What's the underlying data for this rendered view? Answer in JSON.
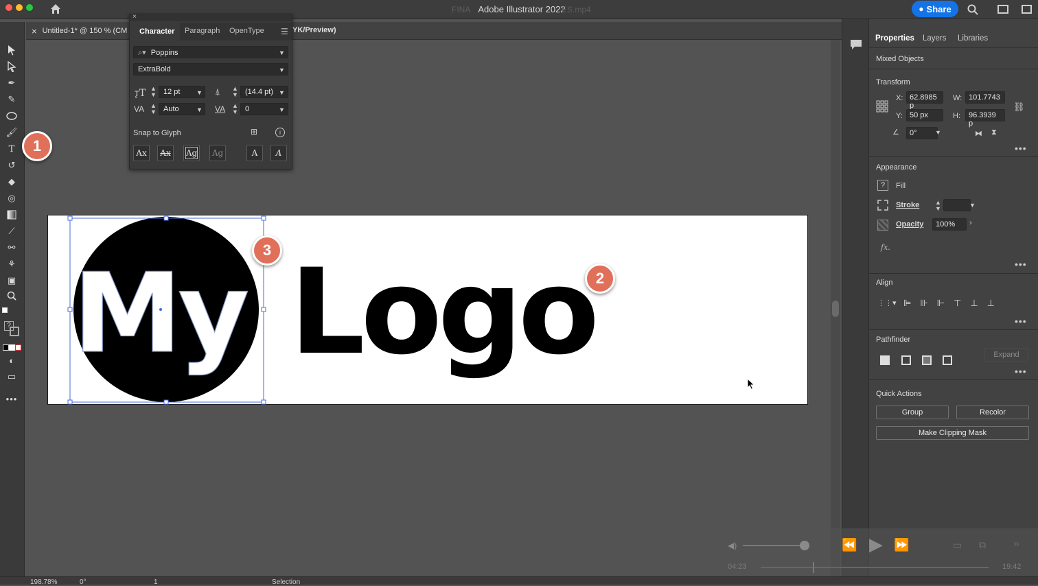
{
  "window": {
    "title": "Adobe Illustrator 2022",
    "faded_filename_left": "FINA",
    "faded_filename_right": "ES.mp4",
    "share_label": "Share"
  },
  "document_tab": {
    "close_glyph": "×",
    "label": "Untitled-1* @ 150 % (CM",
    "label_suffix": "YK/Preview)"
  },
  "character_panel": {
    "tabs": [
      "Character",
      "Paragraph",
      "OpenType"
    ],
    "active_tab": "Character",
    "font_family": "Poppins",
    "font_style": "ExtraBold",
    "font_size": "12 pt",
    "leading": "(14.4 pt)",
    "kerning": "Auto",
    "tracking": "0",
    "snap_to_glyph_label": "Snap to Glyph",
    "glyph_buttons": [
      "Ax",
      "Ax",
      "Ag",
      "Ag",
      "A",
      "A"
    ]
  },
  "artboard": {
    "logo_circle_text": "My",
    "logo_text": "Logo",
    "logo_circle_color": "#000000",
    "logo_text_color": "#000000"
  },
  "badges": [
    "1",
    "2",
    "3"
  ],
  "badge_color": "#e0705a",
  "properties_panel": {
    "tabs": [
      "Properties",
      "Layers",
      "Libraries"
    ],
    "active_tab": "Properties",
    "selection_type": "Mixed Objects",
    "transform": {
      "title": "Transform",
      "x_label": "X:",
      "x_value": "62.8985 p",
      "y_label": "Y:",
      "y_value": "50 px",
      "w_label": "W:",
      "w_value": "101.7743",
      "h_label": "H:",
      "h_value": "96.3939 p",
      "rotate_value": "0°"
    },
    "appearance": {
      "title": "Appearance",
      "fill_label": "Fill",
      "fill_swatch": "?",
      "stroke_label": "Stroke",
      "opacity_label": "Opacity",
      "opacity_value": "100%",
      "fx_label": "fx."
    },
    "align": {
      "title": "Align"
    },
    "pathfinder": {
      "title": "Pathfinder",
      "expand_label": "Expand"
    },
    "quick_actions": {
      "title": "Quick Actions",
      "group_label": "Group",
      "recolor_label": "Recolor",
      "clipping_label": "Make Clipping Mask"
    }
  },
  "statusbar": {
    "zoom": "198.78%",
    "rotation": "0°",
    "artboard_num": "1",
    "tool": "Selection"
  },
  "video_overlay": {
    "elapsed": "04:23",
    "remaining": "19:42"
  },
  "accent_color": "#1473e6"
}
